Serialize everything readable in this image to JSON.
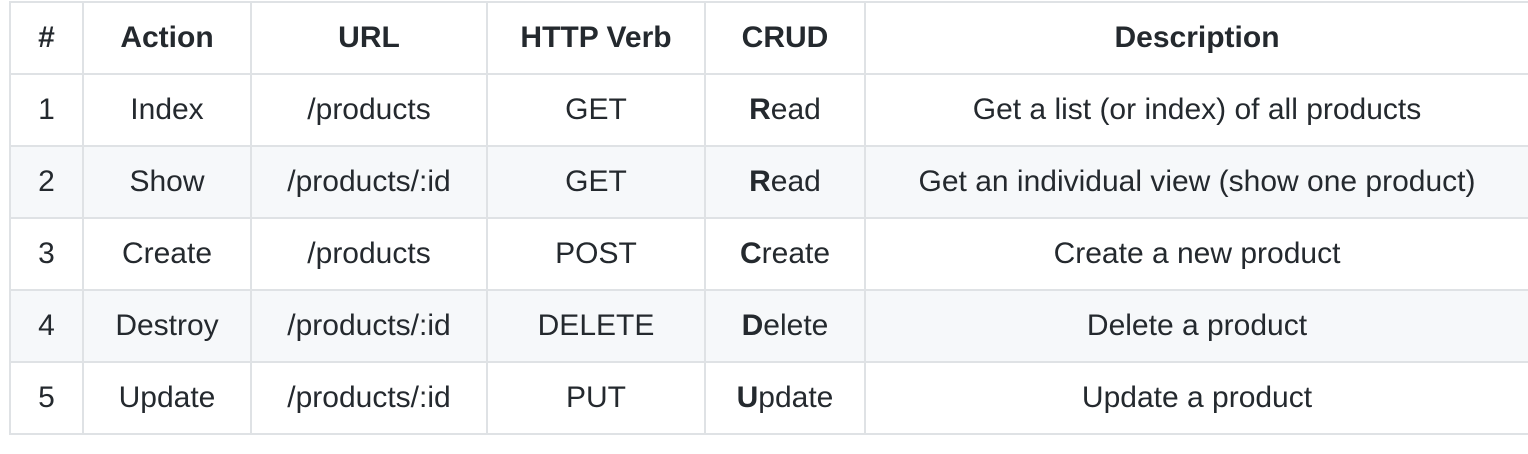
{
  "table": {
    "headers": [
      "#",
      "Action",
      "URL",
      "HTTP Verb",
      "CRUD",
      "Description"
    ],
    "rows": [
      {
        "num": "1",
        "action": "Index",
        "url": "/products",
        "verb": "GET",
        "crud_first": "R",
        "crud_rest": "ead",
        "description": "Get a list (or index) of all products"
      },
      {
        "num": "2",
        "action": "Show",
        "url": "/products/:id",
        "verb": "GET",
        "crud_first": "R",
        "crud_rest": "ead",
        "description": "Get an individual view (show one product)"
      },
      {
        "num": "3",
        "action": "Create",
        "url": "/products",
        "verb": "POST",
        "crud_first": "C",
        "crud_rest": "reate",
        "description": "Create a new product"
      },
      {
        "num": "4",
        "action": "Destroy",
        "url": "/products/:id",
        "verb": "DELETE",
        "crud_first": "D",
        "crud_rest": "elete",
        "description": "Delete a product"
      },
      {
        "num": "5",
        "action": "Update",
        "url": "/products/:id",
        "verb": "PUT",
        "crud_first": "U",
        "crud_rest": "pdate",
        "description": "Update a product"
      }
    ]
  }
}
